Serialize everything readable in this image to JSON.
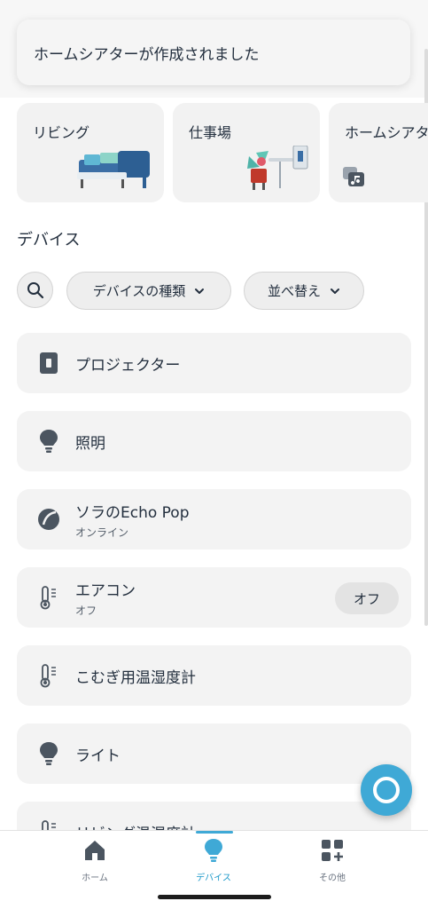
{
  "toast": {
    "message": "ホームシアターが作成されました"
  },
  "groups": [
    {
      "label": "リビング",
      "art": "sofa-illustration"
    },
    {
      "label": "仕事場",
      "art": "desk-plant-illustration"
    },
    {
      "label": "ホームシアタ",
      "art": "music-group-icon"
    }
  ],
  "devices_section": {
    "title": "デバイス",
    "search_icon": "search-icon",
    "filter_type_label": "デバイスの種類",
    "sort_label": "並べ替え"
  },
  "devices": [
    {
      "name": "プロジェクター",
      "icon": "plug-icon",
      "status": ""
    },
    {
      "name": "照明",
      "icon": "bulb-icon",
      "status": ""
    },
    {
      "name": "ソラのEcho Pop",
      "icon": "echo-pop-icon",
      "status": "オンライン"
    },
    {
      "name": "エアコン",
      "icon": "thermometer-icon",
      "status": "オフ",
      "action": "オフ"
    },
    {
      "name": "こむぎ用温湿度計",
      "icon": "thermometer-icon",
      "status": ""
    },
    {
      "name": "ライト",
      "icon": "bulb-icon",
      "status": ""
    },
    {
      "name": "リビング温湿度計",
      "icon": "thermometer-icon",
      "status": ""
    }
  ],
  "tabbar": {
    "items": [
      {
        "label": "ホーム",
        "icon": "home-icon",
        "active": false
      },
      {
        "label": "デバイス",
        "icon": "bulb-icon",
        "active": true
      },
      {
        "label": "その他",
        "icon": "grid-plus-icon",
        "active": false
      }
    ]
  },
  "colors": {
    "accent": "#3fa9d6",
    "text": "#232f3e",
    "card": "#f3f3f3"
  }
}
